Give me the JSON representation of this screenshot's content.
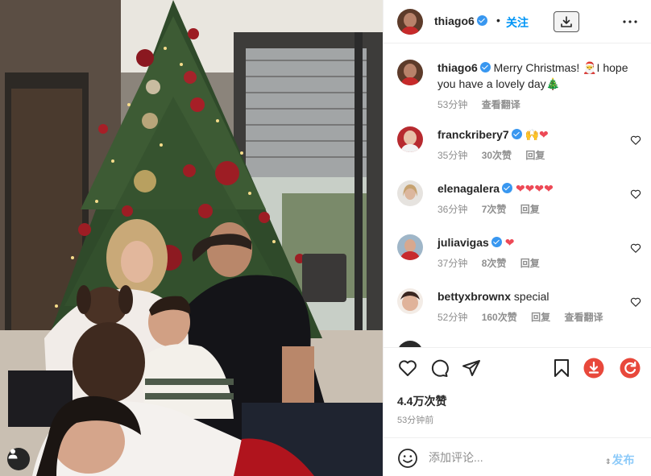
{
  "header": {
    "username": "thiago6",
    "separator": "•",
    "follow_label": "关注"
  },
  "caption": {
    "username": "thiago6",
    "text": "Merry Christmas! 🎅I hope you have a lovely day🎄",
    "time": "53分钟",
    "translate_label": "查看翻译"
  },
  "comments": [
    {
      "username": "franckribery7",
      "text": "🙌❤",
      "time": "35分钟",
      "likes": "30次赞",
      "reply_label": "回复",
      "translate_label": ""
    },
    {
      "username": "elenagalera",
      "text": "❤❤❤❤",
      "time": "36分钟",
      "likes": "7次赞",
      "reply_label": "回复",
      "translate_label": ""
    },
    {
      "username": "juliavigas",
      "text": "❤",
      "time": "37分钟",
      "likes": "8次赞",
      "reply_label": "回复",
      "translate_label": ""
    },
    {
      "username": "bettyxbrownx",
      "text": "special",
      "time": "52分钟",
      "likes": "160次赞",
      "reply_label": "回复",
      "translate_label": "查看翻译"
    }
  ],
  "stats": {
    "likes": "4.4万次赞",
    "posted": "53分钟前"
  },
  "add_comment": {
    "placeholder": "添加评论...",
    "post_label": "发布"
  },
  "icons": {
    "heart": "heart-icon",
    "comment": "comment-icon",
    "share": "send-icon",
    "save": "bookmark-icon",
    "download": "download-icon",
    "more": "more-icon",
    "emoji": "emoji-icon",
    "ext_download": "red-download-icon",
    "ext_refresh": "red-refresh-icon"
  },
  "colors": {
    "accent": "#0095f6",
    "verified": "#3897f0",
    "heart": "#ed4956",
    "extension": "#e8483b",
    "muted": "#8e8e8e"
  }
}
